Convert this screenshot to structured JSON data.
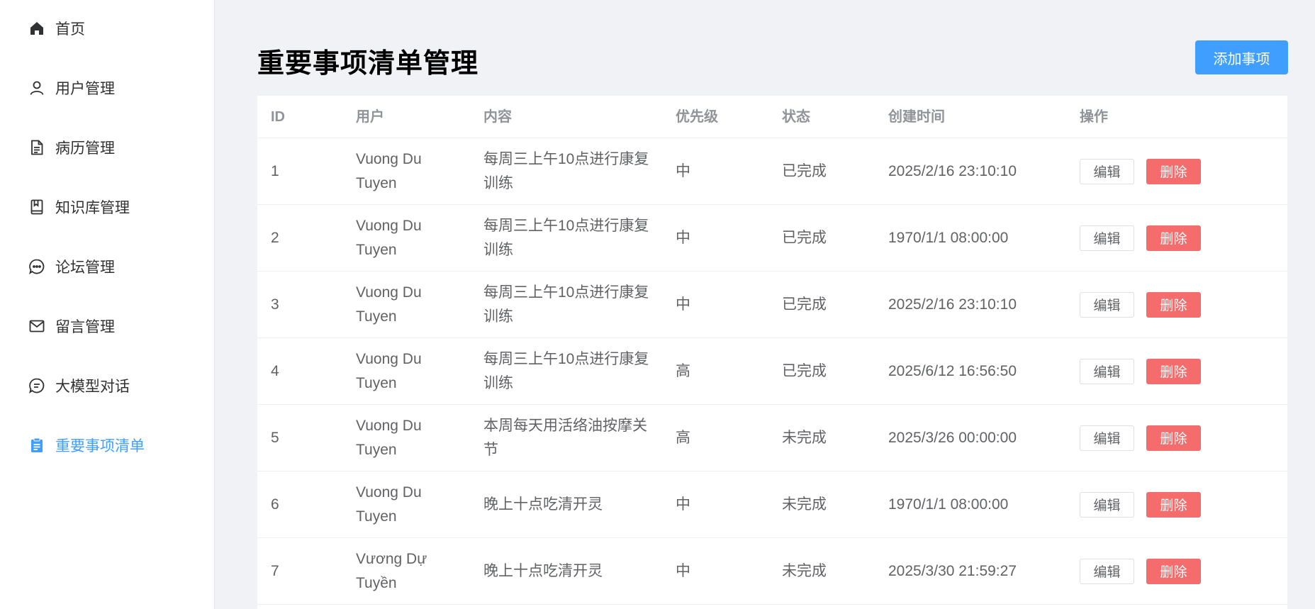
{
  "sidebar": {
    "items": [
      {
        "label": "首页",
        "icon": "home-icon",
        "active": false
      },
      {
        "label": "用户管理",
        "icon": "user-icon",
        "active": false
      },
      {
        "label": "病历管理",
        "icon": "document-icon",
        "active": false
      },
      {
        "label": "知识库管理",
        "icon": "book-icon",
        "active": false
      },
      {
        "label": "论坛管理",
        "icon": "chat-dots-icon",
        "active": false
      },
      {
        "label": "留言管理",
        "icon": "mail-icon",
        "active": false
      },
      {
        "label": "大模型对话",
        "icon": "chat-lines-icon",
        "active": false
      },
      {
        "label": "重要事项清单",
        "icon": "clipboard-icon",
        "active": true
      }
    ],
    "active_color": "#409eff"
  },
  "page": {
    "title": "重要事项清单管理",
    "add_button": "添加事项"
  },
  "table": {
    "headers": {
      "id": "ID",
      "user": "用户",
      "content": "内容",
      "priority": "优先级",
      "status": "状态",
      "created": "创建时间",
      "ops": "操作"
    },
    "rows": [
      {
        "id": "1",
        "user": [
          "Vuong Du",
          "Tuyen"
        ],
        "content": [
          "每周三上午10点进行康复",
          "训练"
        ],
        "priority": "中",
        "status": "已完成",
        "created": "2025/2/16 23:10:10",
        "edit": "编辑",
        "delete": "删除"
      },
      {
        "id": "2",
        "user": [
          "Vuong Du",
          "Tuyen"
        ],
        "content": [
          "每周三上午10点进行康复",
          "训练"
        ],
        "priority": "中",
        "status": "已完成",
        "created": "1970/1/1 08:00:00",
        "edit": "编辑",
        "delete": "删除"
      },
      {
        "id": "3",
        "user": [
          "Vuong Du",
          "Tuyen"
        ],
        "content": [
          "每周三上午10点进行康复",
          "训练"
        ],
        "priority": "中",
        "status": "已完成",
        "created": "2025/2/16 23:10:10",
        "edit": "编辑",
        "delete": "删除"
      },
      {
        "id": "4",
        "user": [
          "Vuong Du",
          "Tuyen"
        ],
        "content": [
          "每周三上午10点进行康复",
          "训练"
        ],
        "priority": "高",
        "status": "已完成",
        "created": "2025/6/12 16:56:50",
        "edit": "编辑",
        "delete": "删除"
      },
      {
        "id": "5",
        "user": [
          "Vuong Du",
          "Tuyen"
        ],
        "content": [
          "本周每天用活络油按摩关",
          "节"
        ],
        "priority": "高",
        "status": "未完成",
        "created": "2025/3/26 00:00:00",
        "edit": "编辑",
        "delete": "删除"
      },
      {
        "id": "6",
        "user": [
          "Vuong Du",
          "Tuyen"
        ],
        "content": [
          "晚上十点吃清开灵"
        ],
        "priority": "中",
        "status": "未完成",
        "created": "1970/1/1 08:00:00",
        "edit": "编辑",
        "delete": "删除"
      },
      {
        "id": "7",
        "user": [
          "Vương Dự",
          "Tuyền"
        ],
        "content": [
          "晚上十点吃清开灵"
        ],
        "priority": "中",
        "status": "未完成",
        "created": "2025/3/30 21:59:27",
        "edit": "编辑",
        "delete": "删除"
      }
    ]
  },
  "colors": {
    "primary": "#409eff",
    "danger": "#f56c6c",
    "background": "#f0f2f5"
  }
}
